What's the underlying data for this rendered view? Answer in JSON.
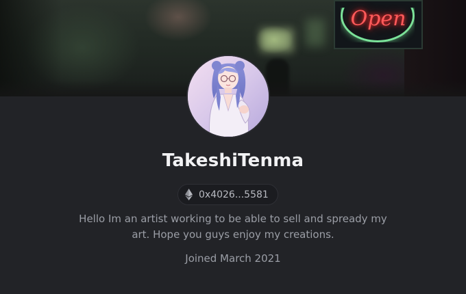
{
  "banner": {
    "sign_text": "Open",
    "sign_color": "#ff5a5a",
    "sign_ring_color": "#7be39a"
  },
  "profile": {
    "username": "TakeshiTenma",
    "wallet": {
      "icon": "ethereum-icon",
      "address": "0x4026...5581"
    },
    "bio_line1": "Hello Im an artist working to be able to sell and spready my",
    "bio_line2": "art. Hope you guys enjoy my creations.",
    "joined": "Joined March 2021"
  },
  "colors": {
    "background": "#222327",
    "username": "#f2f2f4",
    "secondary_text": "#9b9ea6"
  }
}
